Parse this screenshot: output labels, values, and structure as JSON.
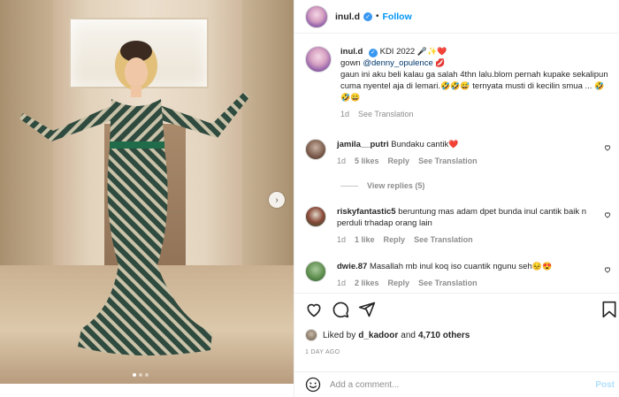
{
  "post": {
    "username": "inul.d",
    "follow_label": "Follow",
    "dot": "•",
    "more_label": "···"
  },
  "caption": {
    "username": "inul.d",
    "title": "KDI 2022",
    "title_emoji": "🎤✨❤️",
    "line1_prefix": "gown",
    "mention": "@denny_opulence",
    "line1_emoji": "💋",
    "text": "gaun ini aku beli kalau ga salah 4thn lalu.blom pernah kupake sekalipun cuma nyentel aja di lemari.",
    "text_emoji": "🤣🤣😅",
    "text2": "ternyata musti di kecilin smua ...",
    "text2_emoji": "🤣🤣😄",
    "time": "1d",
    "see_translation": "See Translation"
  },
  "comments": [
    {
      "username": "jamila__putri",
      "text": "Bundaku cantik",
      "emoji": "❤️",
      "time": "1d",
      "likes": "5 likes",
      "reply": "Reply",
      "see_translation": "See Translation"
    },
    {
      "username": "riskyfantastic5",
      "text": "beruntung mas adam dpet bunda inul cantik baik n perduli trhadap orang lain",
      "emoji": "",
      "time": "1d",
      "likes": "1 like",
      "reply": "Reply",
      "see_translation": "See Translation"
    },
    {
      "username": "dwie.87",
      "text": "Masallah mb inul koq iso cuantik ngunu seh",
      "emoji": "😣😍",
      "time": "1d",
      "likes": "2 likes",
      "reply": "Reply",
      "see_translation": "See Translation"
    }
  ],
  "view_replies": "View replies (5)",
  "likes": {
    "prefix": "Liked by",
    "user": "d_kadoor",
    "conj": "and",
    "others": "4,710 others"
  },
  "date": "1 DAY AGO",
  "add_comment": {
    "placeholder": "Add a comment...",
    "post_label": "Post"
  },
  "colors": {
    "link": "#00376b",
    "follow": "#0095f6",
    "muted": "#8e8e8e",
    "heart": "#ed4956"
  },
  "icons": [
    "verified-icon",
    "heart-icon",
    "comment-icon",
    "share-icon",
    "bookmark-icon",
    "emoji-icon",
    "chevron-right-icon"
  ]
}
